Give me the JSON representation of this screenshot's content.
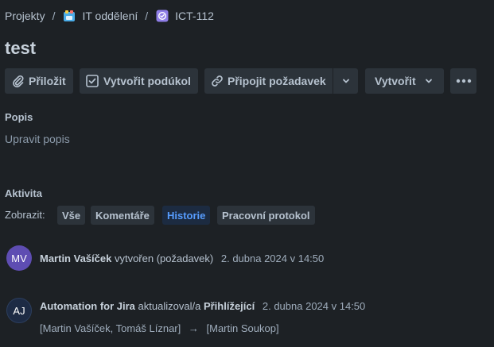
{
  "breadcrumb": {
    "items": [
      {
        "label": "Projekty"
      },
      {
        "label": "IT oddělení"
      },
      {
        "label": "ICT-112"
      }
    ],
    "separator": "/"
  },
  "issue": {
    "title": "test"
  },
  "toolbar": {
    "attach_label": "Přiložit",
    "create_subtask_label": "Vytvořit podúkol",
    "link_issue_label": "Připojit požadavek",
    "create_label": "Vytvořit"
  },
  "description": {
    "heading": "Popis",
    "placeholder": "Upravit popis"
  },
  "activity": {
    "heading": "Aktivita",
    "show_label": "Zobrazit:",
    "filters": [
      {
        "label": "Vše",
        "active": false
      },
      {
        "label": "Komentáře",
        "active": false
      },
      {
        "label": "Historie",
        "active": true
      },
      {
        "label": "Pracovní protokol",
        "active": false
      }
    ],
    "entries": [
      {
        "avatar_initials": "MV",
        "avatar_color": "#5e4db2",
        "author": "Martin Vašíček",
        "action": "vytvořen (požadavek)",
        "timestamp": "2. dubna 2024 v 14:50"
      },
      {
        "avatar_initials": "AJ",
        "avatar_color": "#1d2b44",
        "author": "Automation for Jira",
        "action": "aktualizoval/a",
        "field": "Přihlížející",
        "timestamp": "2. dubna 2024 v 14:50",
        "from_value": "[Martin Vašíček, Tomáš Líznar]",
        "arrow": "→",
        "to_value": "[Martin Soukop]"
      }
    ]
  },
  "colors": {
    "background": "#1d2125",
    "button_bg": "#2c333a",
    "active_filter_bg": "#1c2b41",
    "active_filter_text": "#579dff",
    "ticket_icon": "#8f7ee7"
  },
  "icons": {
    "project_icon": "it-department-project-icon",
    "ticket_icon": "ticket-check-icon",
    "attach_icon": "paperclip-icon",
    "subtask_icon": "subtask-icon",
    "link_icon": "link-icon",
    "dropdown_icon": "chevron-down-icon",
    "more_icon": "more-dots-icon"
  }
}
